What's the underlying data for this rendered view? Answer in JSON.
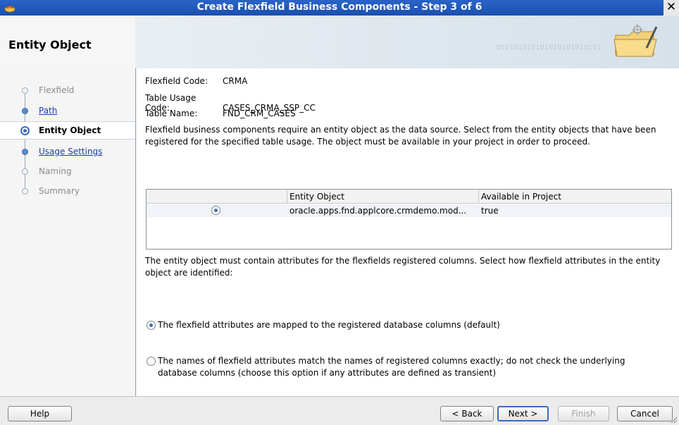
{
  "window": {
    "title": "Create Flexfield Business Components - Step 3 of 6",
    "close_label": "✕"
  },
  "banner": {
    "heading": "Entity Object",
    "binary_text": "010101010101010101010101"
  },
  "nav": {
    "items": [
      {
        "label": "Flexfield",
        "state": "disabled"
      },
      {
        "label": "Path",
        "state": "link"
      },
      {
        "label": "Entity Object",
        "state": "current"
      },
      {
        "label": "Usage Settings",
        "state": "link"
      },
      {
        "label": "Naming",
        "state": "disabled"
      },
      {
        "label": "Summary",
        "state": "disabled"
      }
    ]
  },
  "main": {
    "fields": [
      {
        "key": "Flexfield Code:",
        "value": "CRMA"
      },
      {
        "key": "Table Usage Code:",
        "value": "CASES_CRMA_SSP_CC"
      },
      {
        "key": "Table Name:",
        "value": "FND_CRM_CASES"
      }
    ],
    "description": "Flexfield business components require an entity object as the data source.  Select from the entity objects that have been registered for the specified table usage.  The object must be available in your project in order to proceed.",
    "table": {
      "columns": [
        "",
        "Entity Object",
        "Available in Project"
      ],
      "rows": [
        {
          "selected": true,
          "entity_object": "oracle.apps.fnd.applcore.crmdemo.mod...",
          "available": "true"
        }
      ]
    },
    "attr_description": "The entity object must contain attributes for the flexfields registered columns.  Select how flexfield attributes in the entity object are identified:",
    "options": [
      {
        "label": "The flexfield attributes are mapped to the registered database columns (default)",
        "selected": true
      },
      {
        "label": "The names of flexfield attributes match the names of registered columns exactly; do not check the underlying database columns (choose this option if any attributes are defined as transient)",
        "selected": false
      }
    ]
  },
  "footer": {
    "help": "Help",
    "back": "< Back",
    "next": "Next >",
    "finish": "Finish",
    "cancel": "Cancel"
  }
}
